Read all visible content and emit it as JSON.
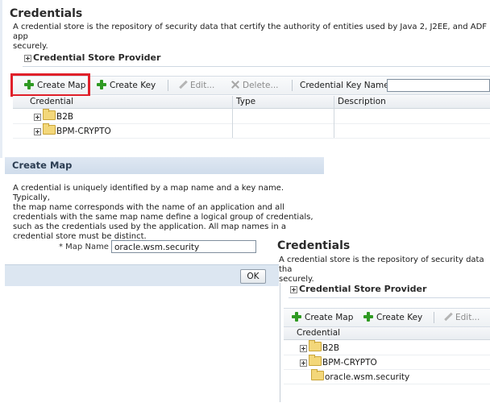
{
  "top": {
    "title": "Credentials",
    "description_line1": "A credential store is the repository of security data that certify the authority of entities used by Java 2, J2EE, and ADF app",
    "description_line2": "securely.",
    "section": "Credential Store Provider",
    "toolbar": {
      "create_map": "Create Map",
      "create_key": "Create Key",
      "edit": "Edit...",
      "delete": "Delete...",
      "key_name_label": "Credential Key Name"
    },
    "columns": [
      "Credential",
      "Type",
      "Description"
    ],
    "rows": [
      "B2B",
      "BPM-CRYPTO"
    ]
  },
  "dialog": {
    "title": "Create Map",
    "text": [
      "A credential is uniquely identified by a map name and a key name. Typically,",
      "the map name corresponds with the name of an application and all",
      "credentials with the same map name define a logical group of credentials,",
      "such as the credentials used by the application. All map names in a",
      "credential store must be distinct."
    ],
    "field_label": "* Map Name",
    "field_value": "oracle.wsm.security",
    "ok": "OK"
  },
  "bottom": {
    "title": "Credentials",
    "description_line1": "A credential store is the repository of security data tha",
    "description_line2": "securely.",
    "section": "Credential Store Provider",
    "toolbar": {
      "create_map": "Create Map",
      "create_key": "Create Key",
      "edit": "Edit..."
    },
    "column": "Credential",
    "rows": [
      "B2B",
      "BPM-CRYPTO",
      "oracle.wsm.security"
    ]
  },
  "colors": {
    "highlight": "#e0202a",
    "accent": "#2f9a23",
    "dialog_header": "#cfdceb"
  }
}
